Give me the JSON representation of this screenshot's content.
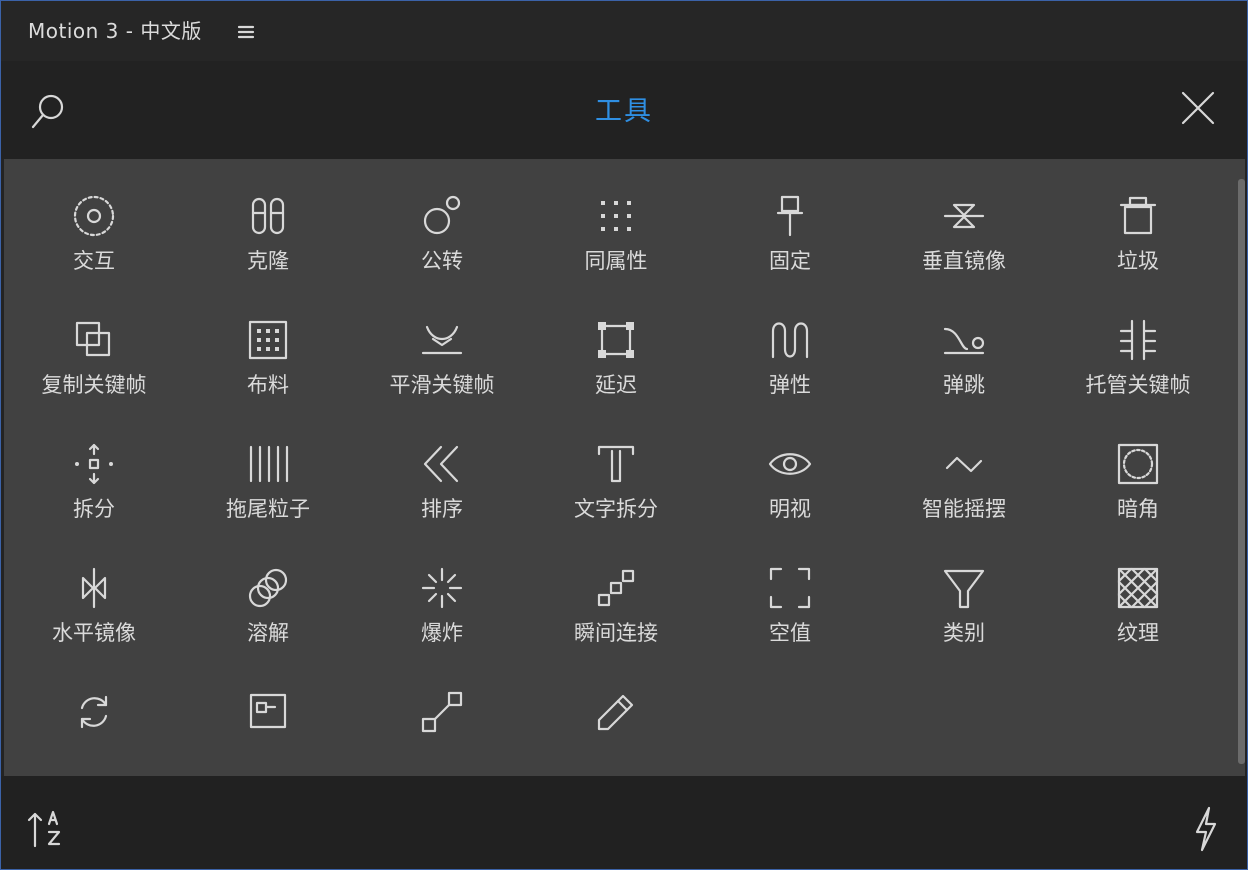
{
  "titlebar": {
    "app_title": "Motion 3 - 中文版"
  },
  "header": {
    "title": "工具"
  },
  "tools": [
    {
      "label": "交互"
    },
    {
      "label": "克隆"
    },
    {
      "label": "公转"
    },
    {
      "label": "同属性"
    },
    {
      "label": "固定"
    },
    {
      "label": "垂直镜像"
    },
    {
      "label": "垃圾"
    },
    {
      "label": "复制关键帧"
    },
    {
      "label": "布料"
    },
    {
      "label": "平滑关键帧"
    },
    {
      "label": "延迟"
    },
    {
      "label": "弹性"
    },
    {
      "label": "弹跳"
    },
    {
      "label": "托管关键帧"
    },
    {
      "label": "拆分"
    },
    {
      "label": "拖尾粒子"
    },
    {
      "label": "排序"
    },
    {
      "label": "文字拆分"
    },
    {
      "label": "明视"
    },
    {
      "label": "智能摇摆"
    },
    {
      "label": "暗角"
    },
    {
      "label": "水平镜像"
    },
    {
      "label": "溶解"
    },
    {
      "label": "爆炸"
    },
    {
      "label": "瞬间连接"
    },
    {
      "label": "空值"
    },
    {
      "label": "类别"
    },
    {
      "label": "纹理"
    }
  ],
  "colors": {
    "accent": "#2f8fe3",
    "panel_bg": "#414141",
    "frame_border": "#3b62a8"
  }
}
